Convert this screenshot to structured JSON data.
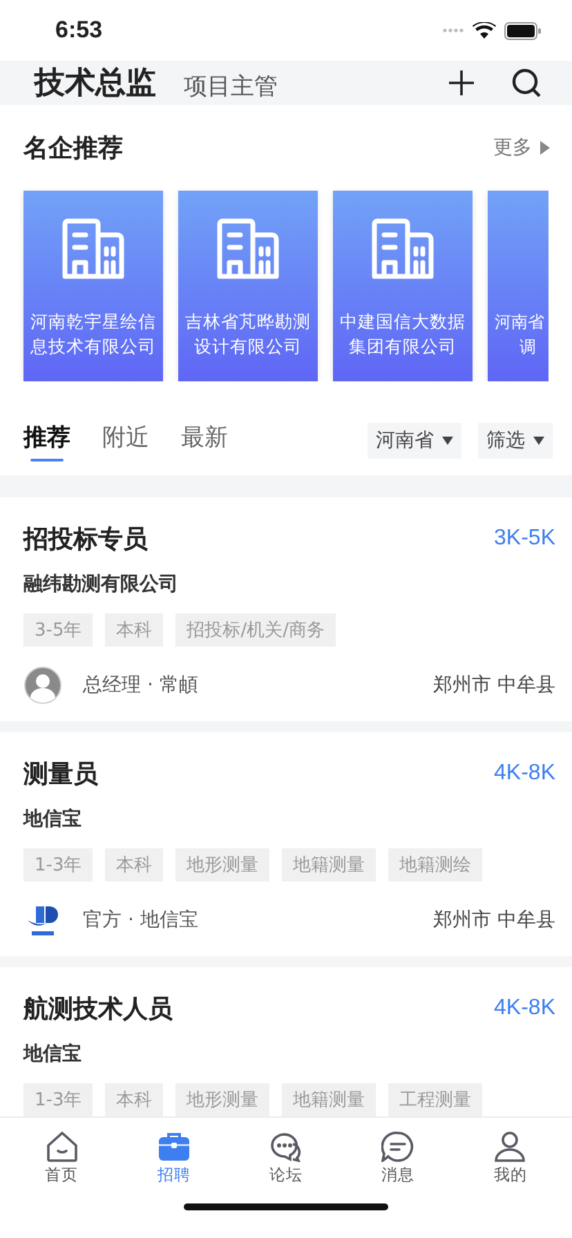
{
  "status_bar": {
    "time": "6:53"
  },
  "header": {
    "title": "技术总监",
    "subtitle": "项目主管"
  },
  "featured": {
    "title": "名企推荐",
    "more": "更多",
    "companies": [
      {
        "lines": [
          "河南乾宇星绘信",
          "息技术有限公司"
        ]
      },
      {
        "lines": [
          "吉林省芃晔勘测",
          "设计有限公司"
        ]
      },
      {
        "lines": [
          "中建国信大数据",
          "集团有限公司"
        ]
      },
      {
        "lines": [
          "河南省",
          "调"
        ]
      }
    ]
  },
  "filter_tabs": [
    {
      "label": "推荐",
      "selected": true
    },
    {
      "label": "附近",
      "selected": false
    },
    {
      "label": "最新",
      "selected": false
    }
  ],
  "dropdowns": [
    "河南省",
    "筛选"
  ],
  "jobs": [
    {
      "title": "招投标专员",
      "salary": "3K-5K",
      "company": "融纬勘测有限公司",
      "tags": [
        "3-5年",
        "本科",
        "招投标/机关/商务"
      ],
      "recruiter": {
        "kind": "person",
        "text": "总经理 · 常頔"
      },
      "location": "郑州市 中牟县"
    },
    {
      "title": "测量员",
      "salary": "4K-8K",
      "company": "地信宝",
      "tags": [
        "1-3年",
        "本科",
        "地形测量",
        "地籍测量",
        "地籍测绘"
      ],
      "recruiter": {
        "kind": "logo",
        "text": "官方 · 地信宝"
      },
      "location": "郑州市 中牟县"
    },
    {
      "title": "航测技术人员",
      "salary": "4K-8K",
      "company": "地信宝",
      "tags": [
        "1-3年",
        "本科",
        "地形测量",
        "地籍测量",
        "工程测量"
      ]
    }
  ],
  "tab_bar": [
    {
      "label": "首页",
      "kind": "home",
      "selected": false
    },
    {
      "label": "招聘",
      "kind": "jobs",
      "selected": true
    },
    {
      "label": "论坛",
      "kind": "forum",
      "selected": false
    },
    {
      "label": "消息",
      "kind": "messages",
      "selected": false
    },
    {
      "label": "我的",
      "kind": "profile",
      "selected": false
    }
  ]
}
